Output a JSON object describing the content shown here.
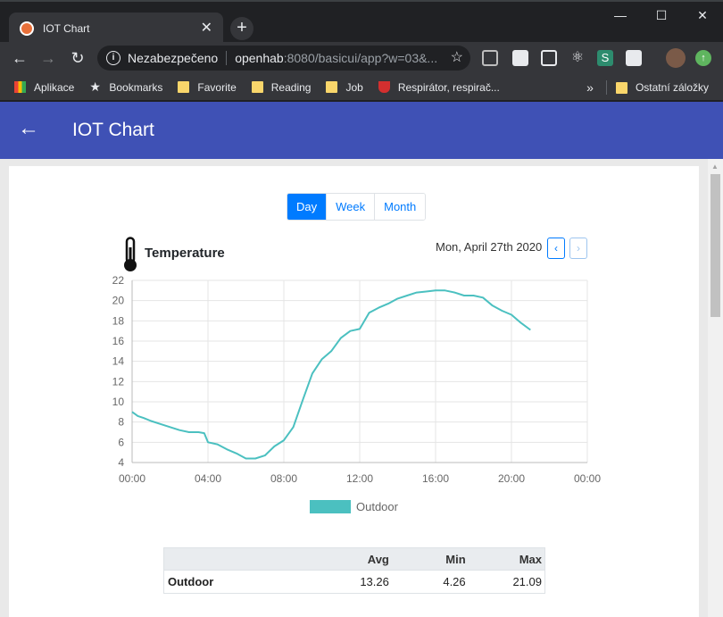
{
  "browser": {
    "tab_title": "IOT Chart",
    "new_tab": "+",
    "close_tab": "✕",
    "window_controls": {
      "minimize": "—",
      "maximize": "☐",
      "close": "✕"
    },
    "security_label": "Nezabezpečeno",
    "url_host": "openhab",
    "url_rest": ":8080/basicui/app?w=03&...",
    "bookmarks": [
      {
        "label": "Aplikace",
        "icon": "apps-grid-icon"
      },
      {
        "label": "Bookmarks",
        "icon": "star-icon"
      },
      {
        "label": "Favorite",
        "icon": "folder-icon"
      },
      {
        "label": "Reading",
        "icon": "folder-icon"
      },
      {
        "label": "Job",
        "icon": "folder-icon"
      },
      {
        "label": "Respirátor, respirač...",
        "icon": "magnet-icon"
      }
    ],
    "overflow": "»",
    "other_bookmarks": "Ostatní záložky"
  },
  "appbar": {
    "title": "IOT Chart",
    "back": "←"
  },
  "range_buttons": [
    {
      "label": "Day",
      "active": true
    },
    {
      "label": "Week",
      "active": false
    },
    {
      "label": "Month",
      "active": false
    }
  ],
  "panel": {
    "title": "Temperature",
    "date": "Mon, April 27th 2020",
    "prev": "‹",
    "next": "›"
  },
  "chart_data": {
    "type": "line",
    "title": "Temperature",
    "x_ticks": [
      "00:00",
      "04:00",
      "08:00",
      "12:00",
      "16:00",
      "20:00",
      "00:00"
    ],
    "y_ticks": [
      4,
      6,
      8,
      10,
      12,
      14,
      16,
      18,
      20,
      22
    ],
    "ylim": [
      4,
      22
    ],
    "grid": true,
    "legend": "bottom",
    "series": [
      {
        "name": "Outdoor",
        "color": "#4bc0c0",
        "x_hours": [
          0,
          0.3,
          0.6,
          1,
          1.5,
          2,
          2.5,
          3,
          3.5,
          3.8,
          4,
          4.5,
          5,
          5.5,
          6,
          6.5,
          7,
          7.5,
          8,
          8.5,
          9,
          9.5,
          10,
          10.5,
          11,
          11.5,
          12,
          12.5,
          13,
          13.5,
          14,
          14.5,
          15,
          15.5,
          16,
          16.5,
          17,
          17.5,
          18,
          18.5,
          19,
          19.5,
          20,
          20.5,
          21
        ],
        "values": [
          9.0,
          8.6,
          8.4,
          8.1,
          7.8,
          7.5,
          7.2,
          7.0,
          7.0,
          6.9,
          6.0,
          5.8,
          5.3,
          4.9,
          4.4,
          4.4,
          4.7,
          5.6,
          6.2,
          7.5,
          10.2,
          12.8,
          14.2,
          15.0,
          16.3,
          17.0,
          17.2,
          18.8,
          19.3,
          19.7,
          20.2,
          20.5,
          20.8,
          20.9,
          21.0,
          21.0,
          20.8,
          20.5,
          20.5,
          20.3,
          19.5,
          19.0,
          18.6,
          17.8,
          17.1
        ]
      }
    ]
  },
  "stats_table": {
    "headers": [
      "",
      "Avg",
      "Min",
      "Max"
    ],
    "rows": [
      {
        "name": "Outdoor",
        "avg": "13.26",
        "min": "4.26",
        "max": "21.09"
      }
    ]
  }
}
